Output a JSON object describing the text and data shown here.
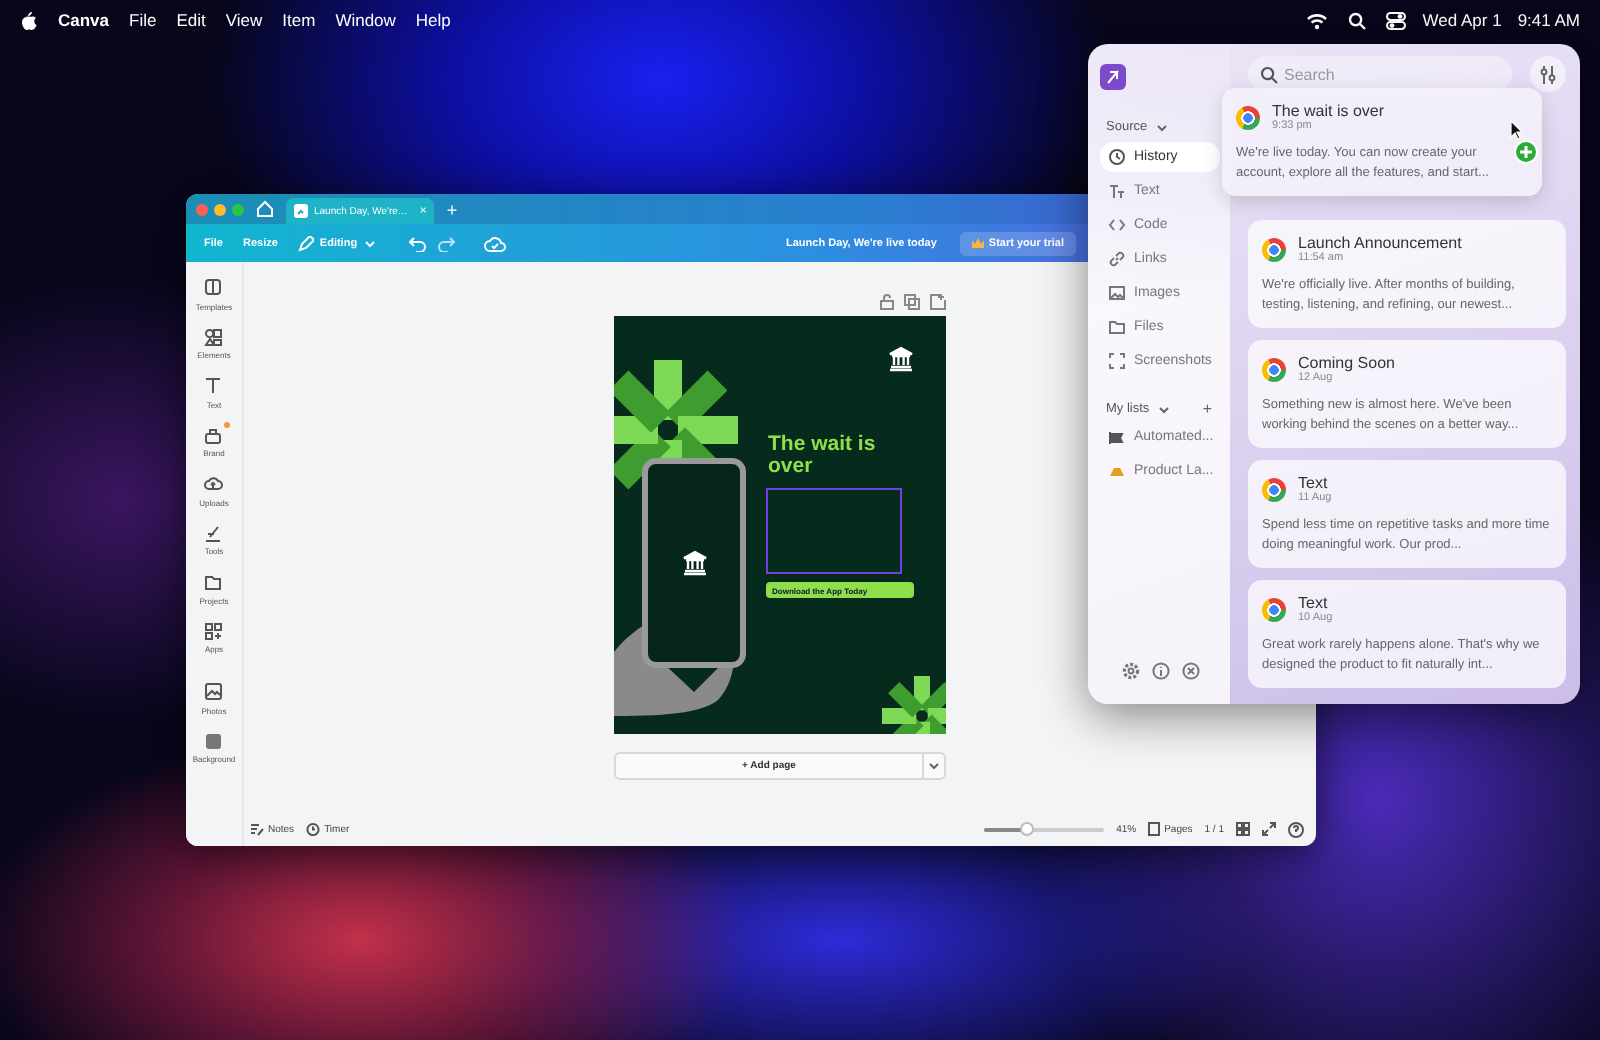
{
  "menu_bar": {
    "app": "Canva",
    "items": [
      "File",
      "Edit",
      "View",
      "Item",
      "Window",
      "Help"
    ],
    "date": "Wed Apr 1",
    "time": "9:41 AM"
  },
  "canva": {
    "tab": {
      "title": "Launch Day, We're…",
      "close": "×",
      "selected": true
    },
    "new_tab": "+",
    "toolbar": {
      "file": "File",
      "resize": "Resize",
      "mode": "Editing",
      "title": "Launch Day, We're live today",
      "trial": "Start your trial"
    },
    "sidebar": [
      {
        "label": "Templates",
        "badge": false
      },
      {
        "label": "Elements",
        "badge": false
      },
      {
        "label": "Text",
        "badge": false
      },
      {
        "label": "Brand",
        "badge": true
      },
      {
        "label": "Uploads",
        "badge": false
      },
      {
        "label": "Tools",
        "badge": false
      },
      {
        "label": "Projects",
        "badge": false
      },
      {
        "label": "Apps",
        "badge": false
      },
      {
        "label": "Photos",
        "badge": false
      },
      {
        "label": "Background",
        "badge": false
      }
    ],
    "design": {
      "headline": "The wait is over",
      "button": "Download the App Today"
    },
    "add_page": "+ Add page",
    "footer": {
      "notes": "Notes",
      "timer": "Timer",
      "zoom": {
        "level": 0.35
      },
      "zoom_reading": "41%",
      "pages": "Pages",
      "page_count": "1 / 1"
    }
  },
  "clipboard": {
    "search": {
      "placeholder": "Search"
    },
    "source": "Source",
    "nav": [
      {
        "label": "History",
        "selected": true
      },
      {
        "label": "Text",
        "selected": false
      },
      {
        "label": "Code",
        "selected": false
      },
      {
        "label": "Links",
        "selected": false
      },
      {
        "label": "Images",
        "selected": false
      },
      {
        "label": "Files",
        "selected": false
      },
      {
        "label": "Screenshots",
        "selected": false
      }
    ],
    "lists_title": "My lists",
    "add": "+",
    "lists": [
      "Automated...",
      "Product La..."
    ],
    "dragged_card": {
      "title": "The wait is over",
      "time": "9:33 pm",
      "text": "We're live today. You can now create your account, explore all the features, and start..."
    },
    "cards": [
      {
        "title": "Launch Announcement",
        "time": "11:54 am",
        "text": "We're officially live. After months of building, testing, listening, and refining, our newest..."
      },
      {
        "title": "Coming Soon",
        "time": "12 Aug",
        "text": "Something new is almost here. We've been working behind the scenes on a better way..."
      },
      {
        "title": "Text",
        "time": "11 Aug",
        "text": "Spend less time on repetitive tasks and more time doing meaningful work. Our prod..."
      },
      {
        "title": "Text",
        "time": "10 Aug",
        "text": "Great work rarely happens alone. That's why we designed the product to fit naturally int..."
      }
    ]
  }
}
